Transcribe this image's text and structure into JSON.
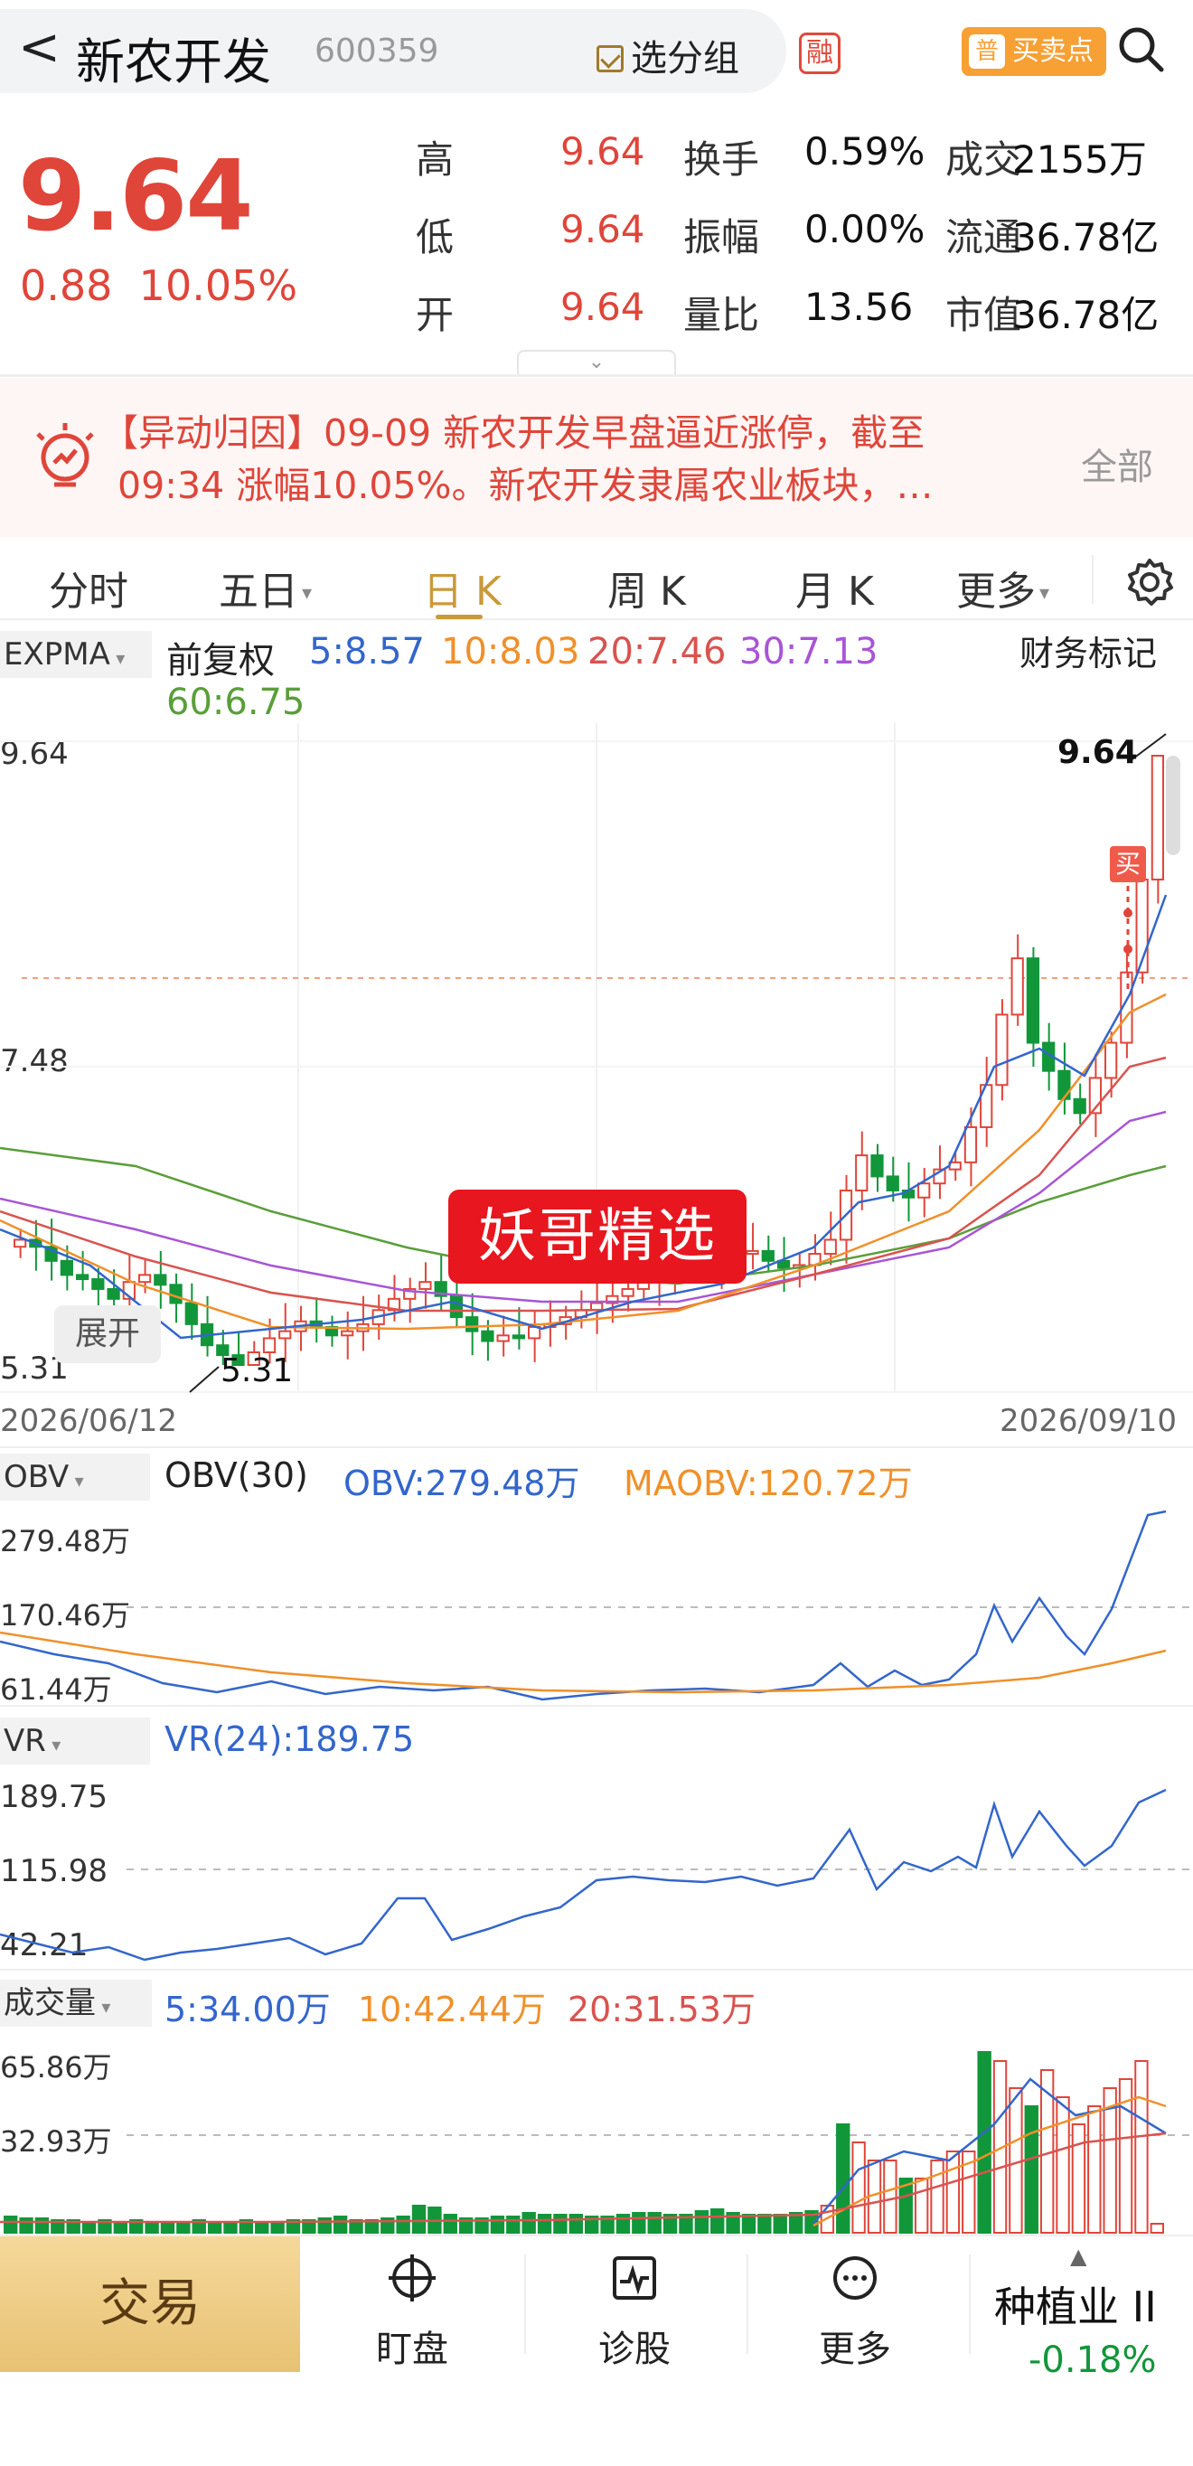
{
  "header": {
    "back": "<",
    "title": "新农开发",
    "code": "600359",
    "group": "选分组",
    "rong": "融",
    "buy_sell_badge": "普",
    "buy_sell": "买卖点"
  },
  "quote": {
    "price": "9.64",
    "change": "0.88",
    "pct": "10.05%",
    "rows": [
      {
        "l1": "高",
        "v1": "9.64",
        "l2": "换手",
        "v2": "0.59%",
        "l3": "成交",
        "v3": "2155万"
      },
      {
        "l1": "低",
        "v1": "9.64",
        "l2": "振幅",
        "v2": "0.00%",
        "l3": "流通",
        "v3": "36.78亿"
      },
      {
        "l1": "开",
        "v1": "9.64",
        "l2": "量比",
        "v2": "13.56",
        "l3": "市值",
        "v3": "36.78亿"
      }
    ]
  },
  "news": {
    "line1": "【异动归因】09-09 新农开发早盘逼近涨停，截至",
    "line2": "09:34 涨幅10.05%。新农开发隶属农业板块，…",
    "all": "全部"
  },
  "tabs": [
    {
      "label": "分时"
    },
    {
      "label": "五日"
    },
    {
      "label": "日 K"
    },
    {
      "label": "周 K"
    },
    {
      "label": "月 K"
    },
    {
      "label": "更多"
    }
  ],
  "colors": {
    "up": "#e0453a",
    "down": "#12963a",
    "ma5": "#3366cc",
    "ma10": "#f0902a",
    "ma20": "#d9534f",
    "ma30": "#a855d6",
    "ma60": "#5a9e3a",
    "accent": "#c99a3a"
  },
  "kline": {
    "indicator": "EXPMA",
    "adjust": "前复权",
    "ma": [
      {
        "label": "5:8.57"
      },
      {
        "label": "10:8.03"
      },
      {
        "label": "20:7.46"
      },
      {
        "label": "30:7.13"
      },
      {
        "label": "60:6.75"
      }
    ],
    "fin_mark": "财务标记",
    "y_top": "9.64",
    "y_mid": "7.48",
    "y_bot": "5.31",
    "max_label": "9.64",
    "min_label": "5.31",
    "buy_mark": "买",
    "date_start": "2026/06/12",
    "date_end": "2026/09/10",
    "expand": "展开",
    "badge": "妖哥精选"
  },
  "chart_data": [
    {
      "type": "candlestick",
      "title": "EXPMA",
      "x_range": [
        "2026/06/12",
        "2026/09/10"
      ],
      "ylim": [
        5.31,
        9.64
      ],
      "series": [
        {
          "name": "5",
          "last": 8.57
        },
        {
          "name": "10",
          "last": 8.03
        },
        {
          "name": "20",
          "last": 7.46
        },
        {
          "name": "30",
          "last": 7.13
        },
        {
          "name": "60",
          "last": 6.75
        }
      ]
    },
    {
      "type": "line",
      "title": "OBV(30)",
      "series": [
        {
          "name": "OBV",
          "last": "279.48万"
        },
        {
          "name": "MAOBV",
          "last": "120.72万"
        }
      ],
      "yticks": [
        "279.48万",
        "170.46万",
        "61.44万"
      ]
    },
    {
      "type": "line",
      "title": "VR",
      "series": [
        {
          "name": "VR(24)",
          "last": "189.75"
        }
      ],
      "yticks": [
        "189.75",
        "115.98",
        "42.21"
      ]
    },
    {
      "type": "bar",
      "title": "成交量",
      "series": [
        {
          "name": "5",
          "last": "34.00万"
        },
        {
          "name": "10",
          "last": "42.44万"
        },
        {
          "name": "20",
          "last": "31.53万"
        }
      ],
      "yticks": [
        "65.86万",
        "32.93万"
      ]
    }
  ],
  "obv": {
    "label": "OBV",
    "title": "OBV(30)",
    "v1": "OBV:279.48万",
    "v2": "MAOBV:120.72万",
    "y1": "279.48万",
    "y2": "170.46万",
    "y3": "61.44万"
  },
  "vr": {
    "label": "VR",
    "v1": "VR(24):189.75",
    "y1": "189.75",
    "y2": "115.98",
    "y3": "42.21"
  },
  "vol": {
    "label": "成交量",
    "v1": "5:34.00万",
    "v2": "10:42.44万",
    "v3": "20:31.53万",
    "y1": "65.86万",
    "y2": "32.93万"
  },
  "footer": {
    "trade": "交易",
    "watch": "盯盘",
    "diag": "诊股",
    "more": "更多",
    "sector": "种植业 II",
    "sector_pct": "-0.18%"
  }
}
